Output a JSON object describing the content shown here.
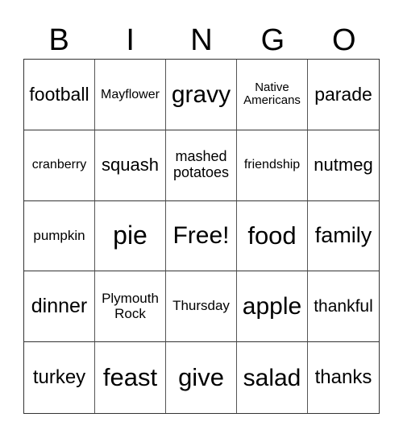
{
  "header": [
    "B",
    "I",
    "N",
    "G",
    "O"
  ],
  "cells": [
    {
      "text": "football",
      "size": 23
    },
    {
      "text": "Mayflower",
      "size": 16
    },
    {
      "text": "gravy",
      "size": 30
    },
    {
      "text": "Native\nAmericans",
      "size": 15
    },
    {
      "text": "parade",
      "size": 23
    },
    {
      "text": "cranberry",
      "size": 16
    },
    {
      "text": "squash",
      "size": 22
    },
    {
      "text": "mashed\npotatoes",
      "size": 18
    },
    {
      "text": "friendship",
      "size": 16
    },
    {
      "text": "nutmeg",
      "size": 22
    },
    {
      "text": "pumpkin",
      "size": 17
    },
    {
      "text": "pie",
      "size": 32
    },
    {
      "text": "Free!",
      "size": 30
    },
    {
      "text": "food",
      "size": 31
    },
    {
      "text": "family",
      "size": 27
    },
    {
      "text": "dinner",
      "size": 25
    },
    {
      "text": "Plymouth\nRock",
      "size": 17
    },
    {
      "text": "Thursday",
      "size": 17
    },
    {
      "text": "apple",
      "size": 30
    },
    {
      "text": "thankful",
      "size": 21
    },
    {
      "text": "turkey",
      "size": 24
    },
    {
      "text": "feast",
      "size": 31
    },
    {
      "text": "give",
      "size": 31
    },
    {
      "text": "salad",
      "size": 30
    },
    {
      "text": "thanks",
      "size": 24
    }
  ]
}
